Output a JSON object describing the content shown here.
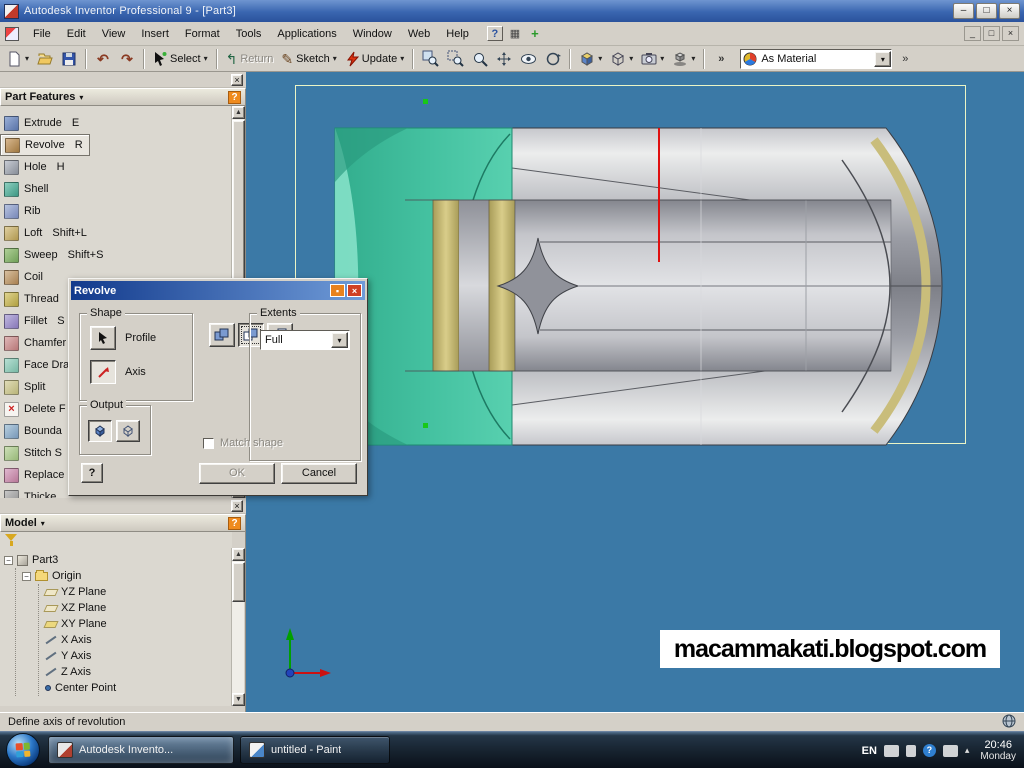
{
  "titlebar": {
    "title": "Autodesk Inventor Professional 9 - [Part3]"
  },
  "menubar": {
    "items": [
      "File",
      "Edit",
      "View",
      "Insert",
      "Format",
      "Tools",
      "Applications",
      "Window",
      "Web",
      "Help"
    ]
  },
  "toolbar": {
    "select": "Select",
    "return": "Return",
    "sketch": "Sketch",
    "update": "Update",
    "material": "As Material"
  },
  "panel": {
    "title": "Part Features",
    "items": [
      {
        "label": "Extrude",
        "shortcut": "E"
      },
      {
        "label": "Revolve",
        "shortcut": "R"
      },
      {
        "label": "Hole",
        "shortcut": "H"
      },
      {
        "label": "Shell",
        "shortcut": ""
      },
      {
        "label": "Rib",
        "shortcut": ""
      },
      {
        "label": "Loft",
        "shortcut": "Shift+L"
      },
      {
        "label": "Sweep",
        "shortcut": "Shift+S"
      },
      {
        "label": "Coil",
        "shortcut": ""
      },
      {
        "label": "Thread",
        "shortcut": ""
      },
      {
        "label": "Fillet",
        "shortcut": "S"
      },
      {
        "label": "Chamfer",
        "shortcut": ""
      },
      {
        "label": "Face Dra",
        "shortcut": ""
      },
      {
        "label": "Split",
        "shortcut": ""
      },
      {
        "label": "Delete F",
        "shortcut": ""
      },
      {
        "label": "Bounda",
        "shortcut": ""
      },
      {
        "label": "Stitch S",
        "shortcut": ""
      },
      {
        "label": "Replace",
        "shortcut": ""
      },
      {
        "label": "Thicke",
        "shortcut": ""
      }
    ]
  },
  "dialog": {
    "title": "Revolve",
    "shape_label": "Shape",
    "profile": "Profile",
    "axis": "Axis",
    "extents_label": "Extents",
    "extents_value": "Full",
    "output_label": "Output",
    "match_shape": "Match shape",
    "help": "?",
    "ok": "OK",
    "cancel": "Cancel"
  },
  "model_panel": {
    "title": "Model",
    "tree": {
      "root": "Part3",
      "origin": "Origin",
      "children": [
        "YZ Plane",
        "XZ Plane",
        "XY Plane",
        "X Axis",
        "Y Axis",
        "Z Axis",
        "Center Point"
      ]
    }
  },
  "viewport": {
    "watermark": "macammakati.blogspot.com"
  },
  "statusbar": {
    "text": "Define axis of revolution"
  },
  "taskbar": {
    "apps": [
      {
        "label": "Autodesk Invento...",
        "active": true
      },
      {
        "label": "untitled - Paint",
        "active": false
      }
    ],
    "tray": {
      "lang": "EN",
      "time": "20:46",
      "day": "Monday"
    }
  },
  "icons": {
    "minimize": "–",
    "maximize": "□",
    "close": "×",
    "mdi_min": "_",
    "mdi_restore": "□",
    "mdi_close": "×",
    "dropdown": "▾",
    "overflow": "»",
    "collapse": "−",
    "panel_close": "×",
    "panel_help": "?",
    "undo": "↶",
    "redo": "↷",
    "return_arrow": "↰",
    "pencil": "✎",
    "hidden_arrow": "▴",
    "help_tray": "?"
  },
  "colors": {
    "viewport_bg": "#3b79a6",
    "selection_teal": "#45c2a1",
    "axis_red": "#e01010",
    "accent_tan": "#c9bd7b",
    "titlebar_blue": "#3a66b0"
  }
}
